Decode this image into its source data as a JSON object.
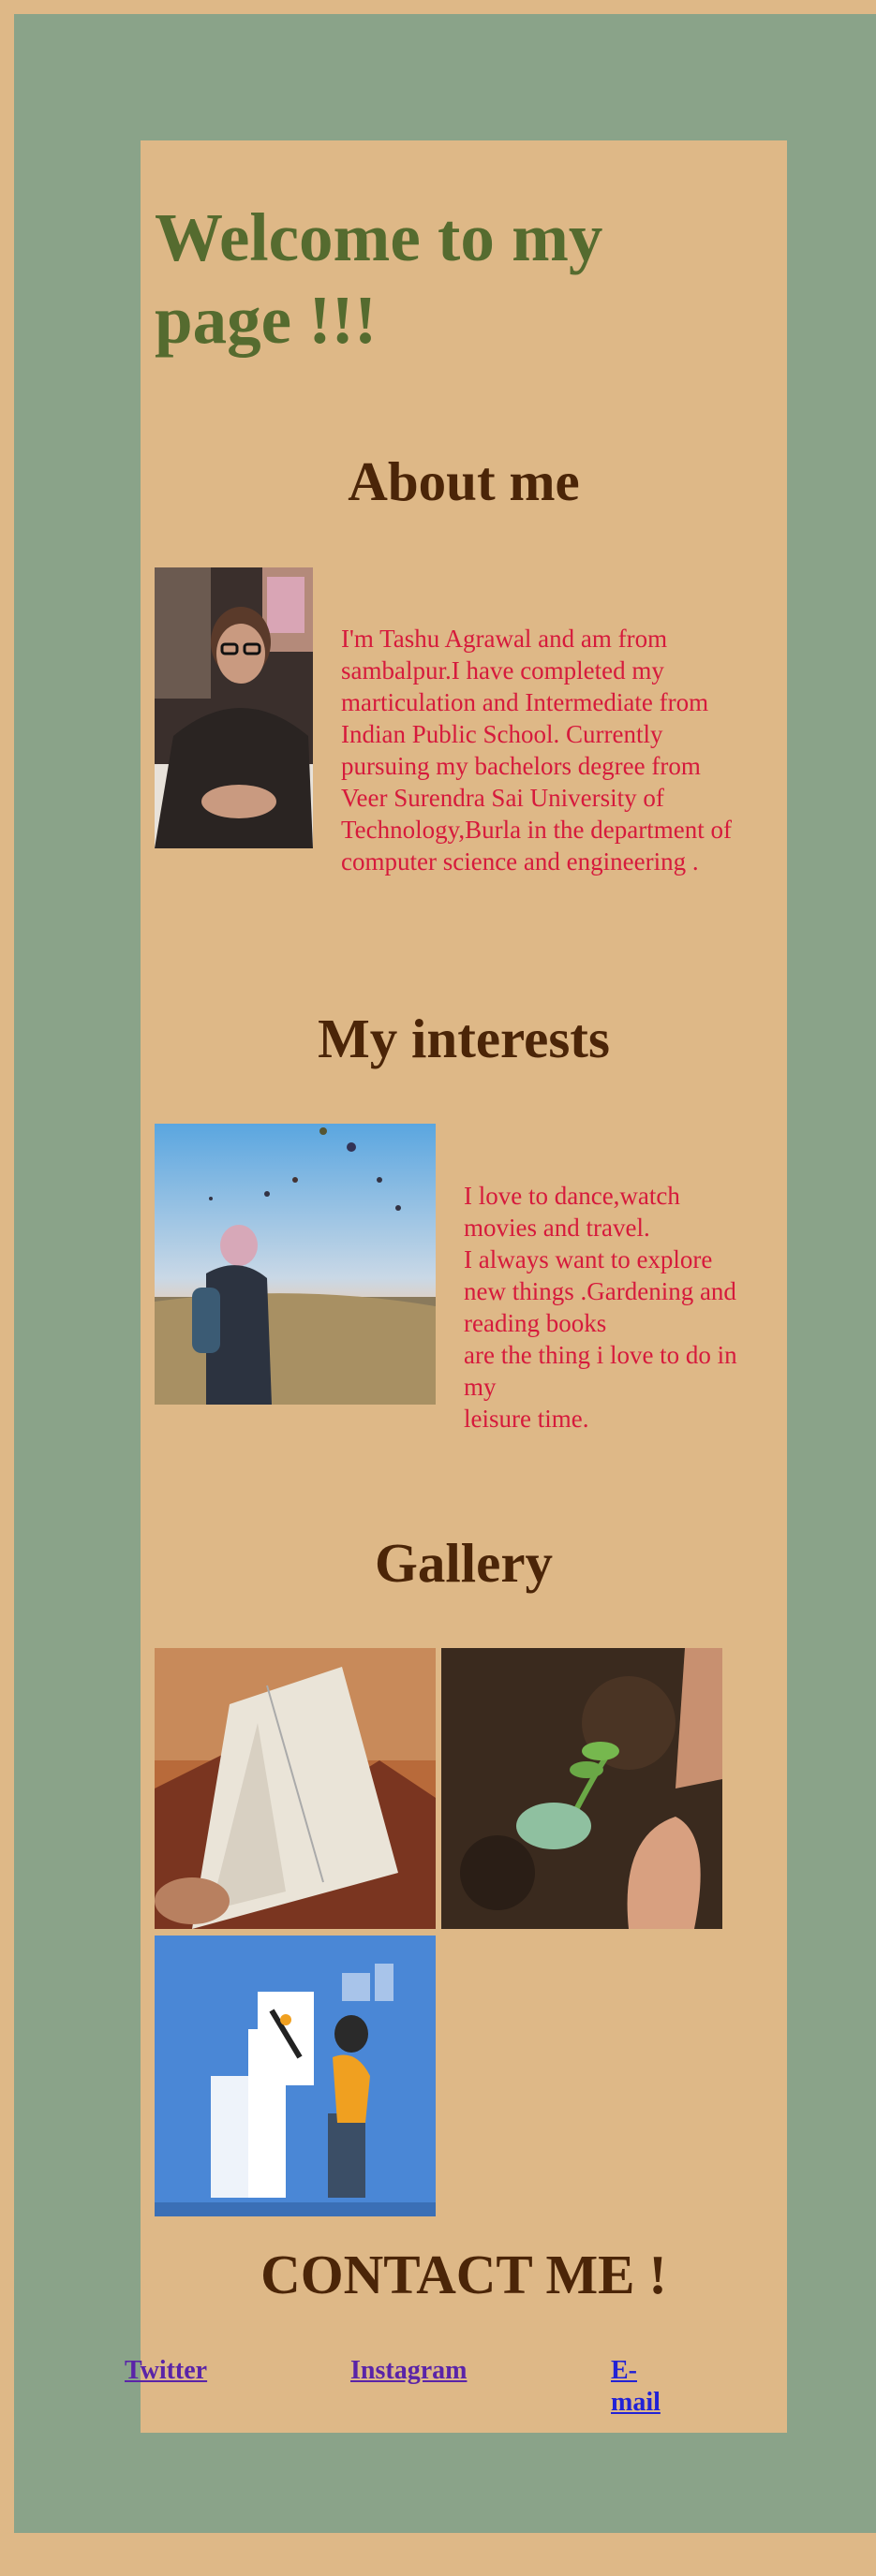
{
  "header": {
    "welcome": "Welcome to my page !!!"
  },
  "about": {
    "title": "About me",
    "text": "I'm Tashu Agrawal and am from sambalpur.I have completed my marticulation and Intermediate from Indian Public School. Currently pursuing my bachelors degree from Veer Surendra Sai University of Technology,Burla in the department of computer science and engineering ."
  },
  "interests": {
    "title": "My interests",
    "lines": [
      "I love to dance,watch movies and travel.",
      "I always want to explore new things .Gardening and reading books",
      "are the thing i love to do in my",
      "leisure time."
    ]
  },
  "gallery": {
    "title": "Gallery"
  },
  "contact": {
    "title": "CONTACT ME !",
    "links": [
      "Twitter",
      "Instagram",
      "E-mail"
    ]
  },
  "colors": {
    "page_border": "#deb887",
    "outer_bg": "#8aa389",
    "card_bg": "#deb887",
    "welcome_text": "#556b2f",
    "heading_text": "#4b2508",
    "body_text": "#d61a3c",
    "link_visited": "#5a24a8",
    "link": "#2222d6"
  }
}
